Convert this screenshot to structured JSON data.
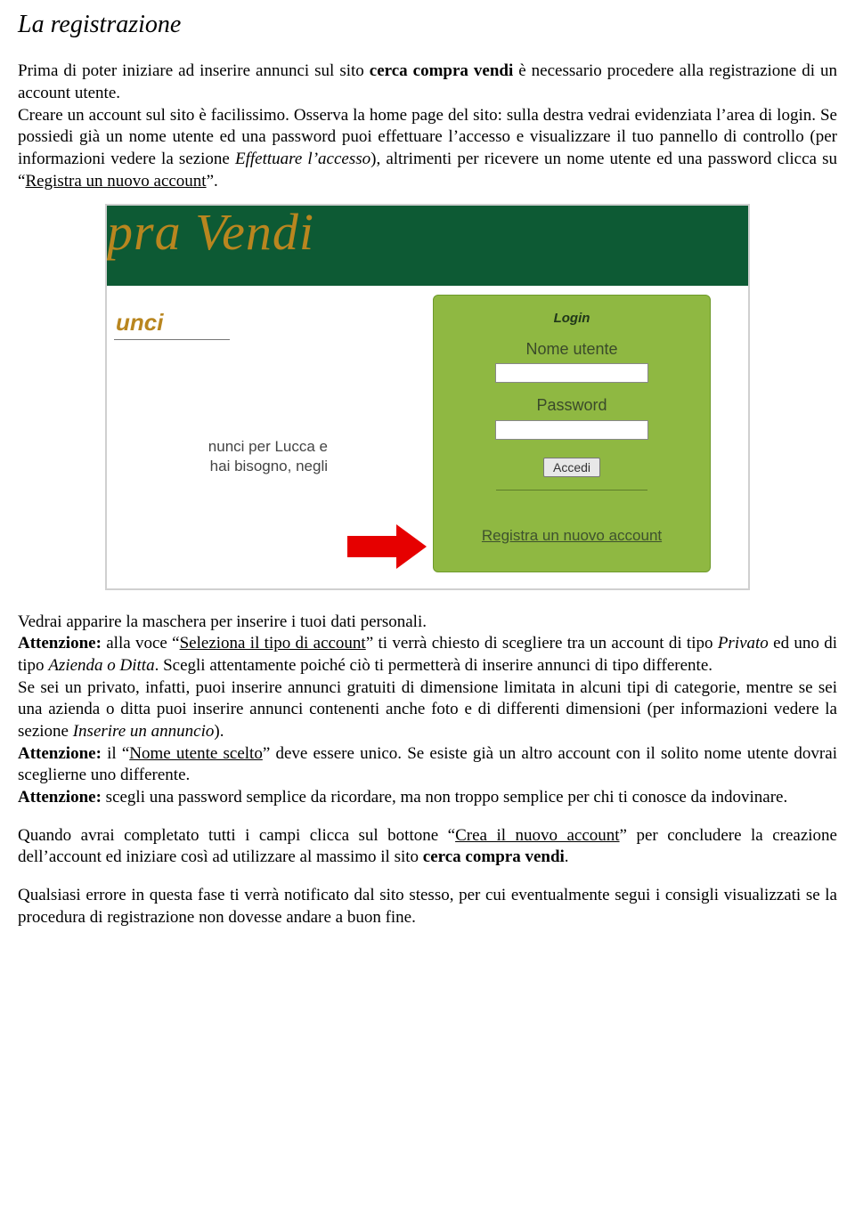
{
  "title": "La registrazione",
  "p1a": "Prima di poter iniziare ad inserire annunci sul sito ",
  "p1b": "cerca compra vendi",
  "p1c": " è necessario procedere alla registrazione di un account utente.",
  "p2a": "Creare un account sul sito è facilissimo. Osserva la home page del sito: sulla destra vedrai evidenziata l’area di login. Se possiedi già un nome utente ed una password puoi effettuare l’accesso e visualizzare il tuo pannello di controllo (per informazioni vedere la sezione ",
  "p2b": "Effettuare l’accesso",
  "p2c": "), altrimenti per ricevere un nome utente ed una password clicca su “",
  "p2d": "Registra un nuovo account",
  "p2e": "”.",
  "shot": {
    "logo": "pra Vendi",
    "unci": "unci",
    "snippet1": "nunci per Lucca e",
    "snippet2": "hai bisogno, negli",
    "login_title": "Login",
    "label_user": "Nome utente",
    "label_pass": "Password",
    "btn": "Accedi",
    "reg_link": "Registra un nuovo account"
  },
  "p3": "Vedrai apparire la maschera per inserire i tuoi dati personali.",
  "p4a": "Attenzione:",
  "p4b": " alla voce “",
  "p4c": "Seleziona il tipo di account",
  "p4d": "” ti verrà chiesto di scegliere tra un account di tipo ",
  "p4e": "Privato",
  "p4f": " ed uno di tipo ",
  "p4g": "Azienda o Ditta",
  "p4h": ". Scegli attentamente poiché ciò ti permetterà di inserire annunci di tipo differente.",
  "p5a": "Se sei un privato, infatti, puoi inserire annunci gratuiti di dimensione limitata in alcuni tipi di categorie, mentre se sei una azienda o ditta puoi inserire annunci contenenti anche foto e di differenti dimensioni (per informazioni vedere la sezione ",
  "p5b": "Inserire un annuncio",
  "p5c": ").",
  "p6a": "Attenzione:",
  "p6b": " il “",
  "p6c": "Nome utente scelto",
  "p6d": "” deve essere unico. Se esiste già un altro account con il solito nome utente dovrai sceglierne uno differente.",
  "p7a": "Attenzione:",
  "p7b": " scegli una password semplice da ricordare, ma non troppo semplice per chi ti conosce da indovinare.",
  "p8a": "Quando avrai completato tutti i campi clicca sul bottone “",
  "p8b": "Crea il nuovo account",
  "p8c": "” per concludere la creazione dell’account ed iniziare così ad utilizzare al massimo il sito ",
  "p8d": "cerca compra vendi",
  "p8e": ".",
  "p9": "Qualsiasi errore in questa fase ti verrà notificato dal sito stesso, per cui eventualmente segui i consigli visualizzati se la procedura di registrazione non dovesse andare a buon fine."
}
